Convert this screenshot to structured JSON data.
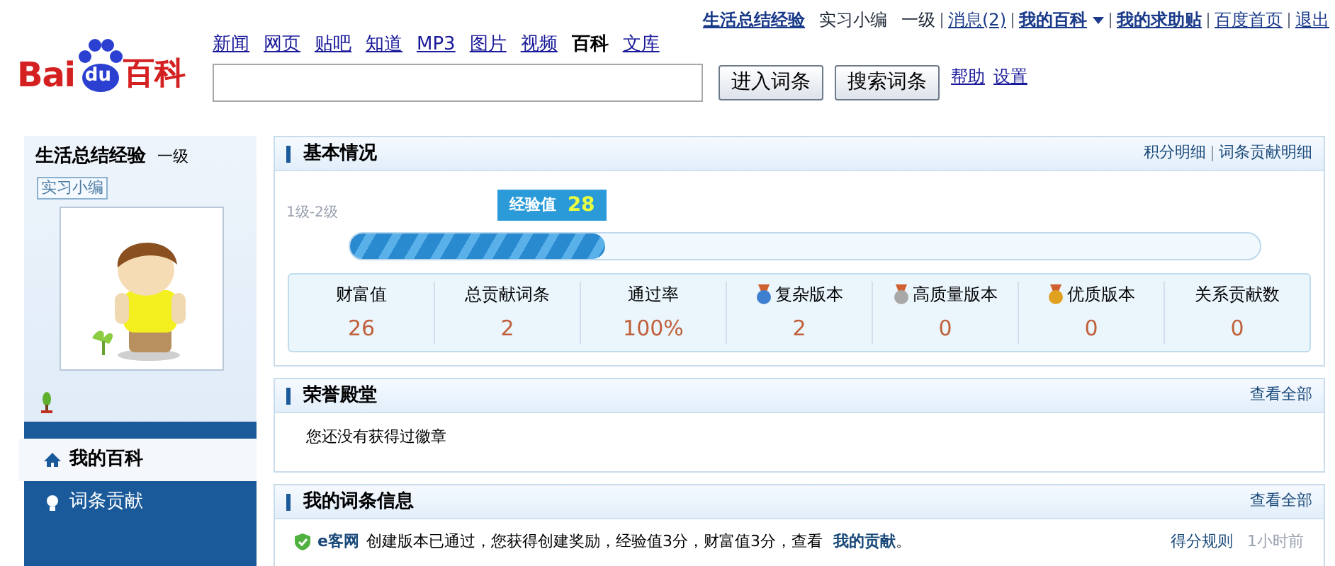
{
  "top_links": [
    {
      "label": "生活总结经验",
      "kind": "link",
      "bold": true
    },
    {
      "label": "实习小编",
      "kind": "text"
    },
    {
      "label": "一级",
      "kind": "text"
    },
    {
      "label": "消息(2)",
      "kind": "link",
      "bold": false
    },
    {
      "label": "我的百科",
      "kind": "menu",
      "bold": true
    },
    {
      "label": "我的求助贴",
      "kind": "link",
      "bold": true
    },
    {
      "label": "百度首页",
      "kind": "link",
      "bold": false
    },
    {
      "label": "退出",
      "kind": "link",
      "bold": false
    }
  ],
  "logo": {
    "latin": "Bai",
    "mark": "du",
    "name": "百科"
  },
  "nav": [
    {
      "label": "新闻",
      "selected": false
    },
    {
      "label": "网页",
      "selected": false
    },
    {
      "label": "贴吧",
      "selected": false
    },
    {
      "label": "知道",
      "selected": false
    },
    {
      "label": "MP3",
      "selected": false
    },
    {
      "label": "图片",
      "selected": false
    },
    {
      "label": "视频",
      "selected": false
    },
    {
      "label": "百科",
      "selected": true
    },
    {
      "label": "文库",
      "selected": false
    }
  ],
  "search": {
    "buttons": [
      "进入词条",
      "搜索词条"
    ],
    "links": [
      "帮助",
      "设置"
    ]
  },
  "sidebar": {
    "user": "生活总结经验",
    "level": "一级",
    "badge": "实习小编",
    "items": [
      {
        "label": "我的百科",
        "selected": true
      },
      {
        "label": "词条贡献",
        "selected": false
      }
    ]
  },
  "basic": {
    "title": "基本情况",
    "links": [
      "积分明细",
      "词条贡献明细"
    ],
    "range": "1级-2级",
    "exp_label": "经验值",
    "exp_value": "28",
    "level": 0.28,
    "stats": [
      {
        "label": "财富值",
        "value": "26"
      },
      {
        "label": "总贡献词条",
        "value": "2"
      },
      {
        "label": "通过率",
        "value": "100%"
      },
      {
        "label": "复杂版本",
        "value": "2",
        "color": "#3f7fd0"
      },
      {
        "label": "高质量版本",
        "value": "0",
        "color": "#a8a8a8"
      },
      {
        "label": "优质版本",
        "value": "0",
        "color": "#e0a020"
      },
      {
        "label": "关系贡献数",
        "value": "0"
      }
    ]
  },
  "honor": {
    "title": "荣誉殿堂",
    "more": "查看全部",
    "empty": "您还没有获得过徽章"
  },
  "entries": {
    "title": "我的词条信息",
    "more": "查看全部",
    "items": [
      {
        "source": "e客网",
        "text": "创建版本已通过，您获得创建奖励，经验值3分，财富值3分，查看",
        "link": "我的贡献",
        "tail": "。",
        "rules": "得分规则",
        "time": "1小时前"
      }
    ]
  }
}
